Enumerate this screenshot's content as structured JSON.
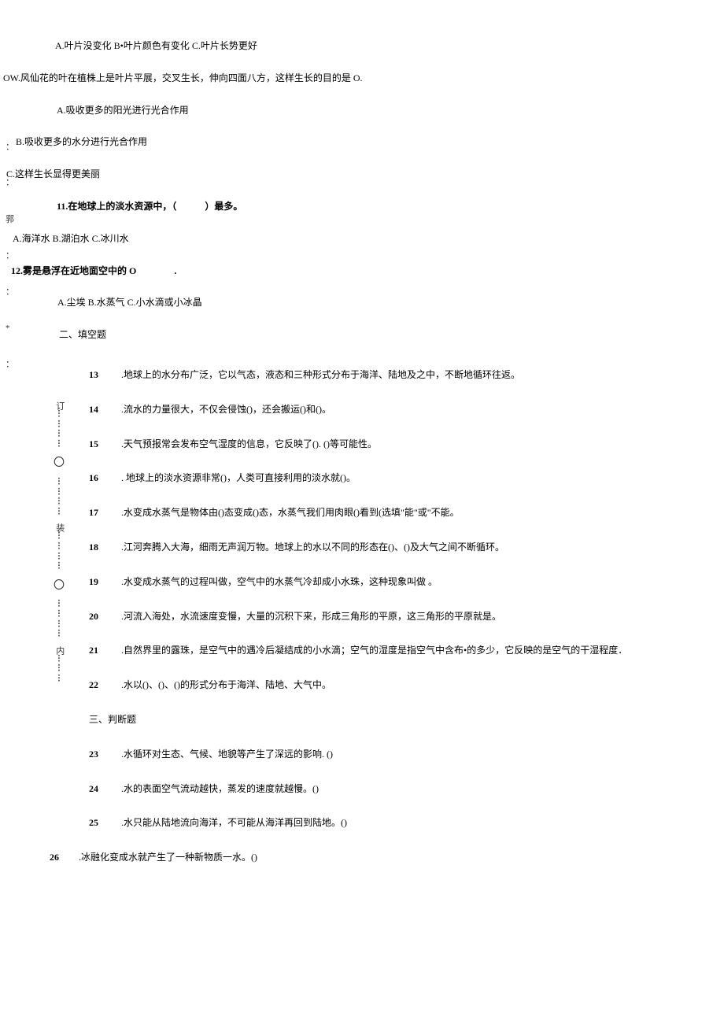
{
  "q9_options": "A.叶片没变化 B•叶片颜色有变化 C.叶片长势更好",
  "q10_text": "OW.风仙花的叶在植株上是叶片平展，交叉生长，伸向四面八方，这样生长的目的是 O.",
  "q10_a": "A.吸收更多的阳光进行光合作用",
  "q10_b": "B.吸收更多的水分进行光合作用",
  "q10_c": "C.这样生长显得更美丽",
  "q11": "11.在地球上的淡水资源中，（　　　）最多。",
  "q11_options": "A.海洋水 B.湖泊水 C.冰川水",
  "q12": "12.雾是悬浮在近地面空中的 O　　　　.",
  "q12_options": "A.尘埃 B.水蒸气 C.小水滴或小冰晶",
  "section2_title": "二、填空题",
  "q13_num": "13",
  "q13_text": ".地球上的水分布广泛，它以气态，液态和三种形式分布于海洋、陆地及之中，不断地循环往返。",
  "q14_num": "14",
  "q14_text": ".流水的力量很大，不仅会侵蚀()，还会搬运()和()。",
  "q15_num": "15",
  "q15_text": ".天气预报常会发布空气湿度的信息，它反映了(). ()等可能性。",
  "q16_num": "16",
  "q16_text": ". 地球上的淡水资源非常()，人类可直接利用的淡水就()。",
  "q17_num": "17",
  "q17_text": ".水变成水蒸气是物体由()态变成()态，水蒸气我们用肉眼()看到(选填\"能\"或\"不能。",
  "q18_num": "18",
  "q18_text": ".江河奔腾入大海，细雨无声润万物。地球上的水以不同的形态在()、()及大气之间不断循环。",
  "q19_num": "19",
  "q19_text": ".水变成水蒸气的过程叫做，空气中的水蒸气冷却成小水珠，这种现象叫做 。",
  "q20_num": "20",
  "q20_text": ".河流入海处，水流速度变慢，大量的沉积下来，形成三角形的平原，这三角形的平原就是。",
  "q21_num": "21",
  "q21_text": ".自然界里的露珠，是空气中的遇冷后凝结成的小水滴；空气的湿度是指空气中含布•的多少，它反映的是空气的干湿程度．",
  "q22_num": "22",
  "q22_text": ".水以()、()、()的形式分布于海洋、陆地、大气中。",
  "section3_title": "三、判断题",
  "q23_num": "23",
  "q23_text": ".水循环对生态、气候、地貌等产生了深远的影响. ()",
  "q24_num": "24",
  "q24_text": ".水的表面空气流动越快，蒸发的速度就越慢。()",
  "q25_num": "25",
  "q25_text": ".水只能从陆地流向海洋，不可能从海洋再回到陆地。()",
  "q26_num": "26",
  "q26_text": ".冰融化变成水就产生了一种新物质一水。()",
  "gutter": {
    "ding": "订",
    "zhuang": "装",
    "nei": "内"
  },
  "margin": {
    "m1": "：",
    "m2": "：",
    "m3": "郛",
    "m4": "：",
    "m5": "：",
    "m6": "*",
    "m7": "："
  }
}
